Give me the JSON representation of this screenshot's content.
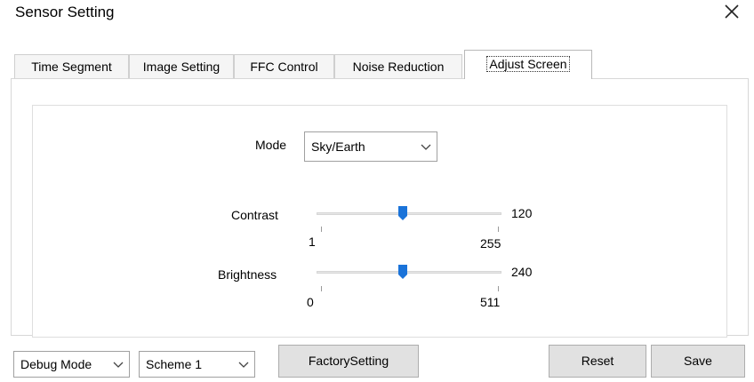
{
  "window": {
    "title": "Sensor Setting",
    "close_icon": "close-icon"
  },
  "tabs": [
    {
      "label": "Time Segment"
    },
    {
      "label": "Image Setting"
    },
    {
      "label": "FFC Control"
    },
    {
      "label": "Noise Reduction"
    },
    {
      "label": "Adjust Screen"
    }
  ],
  "active_tab": "Adjust Screen",
  "mode": {
    "label": "Mode",
    "value": "Sky/Earth"
  },
  "contrast": {
    "label": "Contrast",
    "value": "120",
    "min": "1",
    "max": "255"
  },
  "brightness": {
    "label": "Brightness",
    "value": "240",
    "min": "0",
    "max": "511"
  },
  "footer": {
    "debug_mode": "Debug Mode",
    "scheme": "Scheme 1",
    "factory_setting": "FactorySetting",
    "reset": "Reset",
    "save": "Save"
  },
  "colors": {
    "accent": "#1a73d9",
    "slider_track": "#e6e6e6",
    "button_bg": "#e1e1e1"
  }
}
